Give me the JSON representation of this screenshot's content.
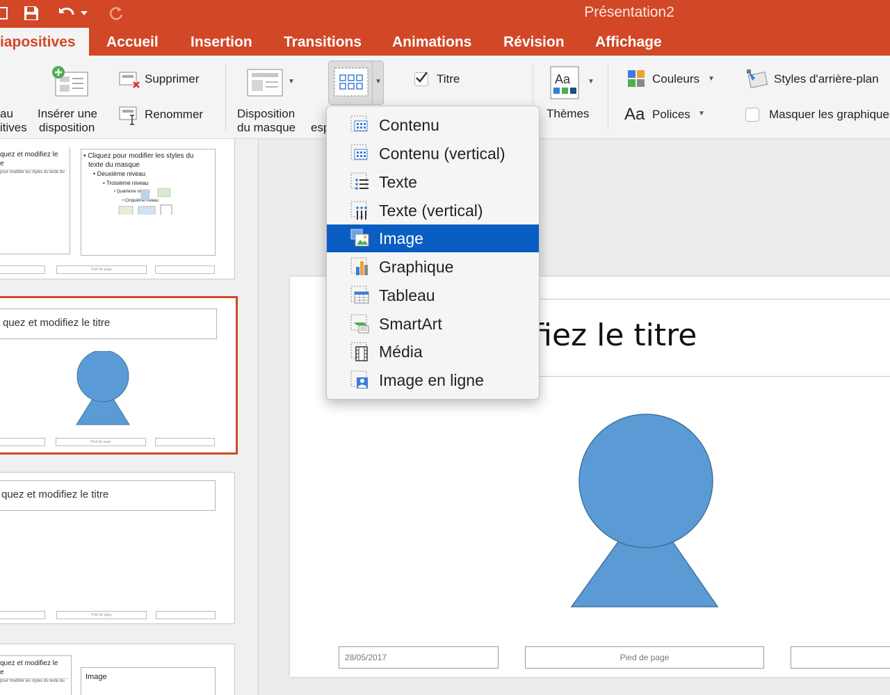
{
  "window": {
    "title": "Présentation2"
  },
  "tabs": [
    {
      "label": "Masque des diapositives",
      "visible_label": "iapositives",
      "active": true
    },
    {
      "label": "Accueil"
    },
    {
      "label": "Insertion"
    },
    {
      "label": "Transitions"
    },
    {
      "label": "Animations"
    },
    {
      "label": "Révision"
    },
    {
      "label": "Affichage"
    }
  ],
  "ribbon": {
    "insert_master_label_1": "au",
    "insert_master_label_2": "itives",
    "insert_layout_label_1": "Insérer une",
    "insert_layout_label_2": "disposition",
    "delete_label": "Supprimer",
    "rename_label": "Renommer",
    "master_layout_label_1": "Disposition",
    "master_layout_label_2": "du masque",
    "insert_placeholder_partial": "esp",
    "title_checkbox_label": "Titre",
    "themes_label": "Thèmes",
    "themes_icon_text": "Aa",
    "colors_label": "Couleurs",
    "fonts_label": "Polices",
    "fonts_icon_text": "Aa",
    "background_styles_label": "Styles d'arrière-plan",
    "hide_graphics_label": "Masquer les graphiques"
  },
  "placeholder_menu": {
    "items": [
      {
        "label": "Contenu",
        "icon": "content-icon"
      },
      {
        "label": "Contenu (vertical)",
        "icon": "content-vertical-icon"
      },
      {
        "label": "Texte",
        "icon": "text-icon"
      },
      {
        "label": "Texte (vertical)",
        "icon": "text-vertical-icon"
      },
      {
        "label": "Image",
        "icon": "image-icon",
        "highlighted": true
      },
      {
        "label": "Graphique",
        "icon": "chart-icon"
      },
      {
        "label": "Tableau",
        "icon": "table-icon"
      },
      {
        "label": "SmartArt",
        "icon": "smartart-icon"
      },
      {
        "label": "Média",
        "icon": "media-icon"
      },
      {
        "label": "Image en ligne",
        "icon": "online-image-icon"
      }
    ]
  },
  "thumbnails": {
    "t1_left_text": "quez et modifiez le",
    "t1_left_text2": "e",
    "t1_tiny": "pour modifier les styles du texte du",
    "t1_right_bullet1": "• Cliquez pour modifier les styles du",
    "t1_right_bullet1b": "texte du masque",
    "t1_right_bullet2": "• Deuxième niveau",
    "t1_right_bullet3": "• Troisième niveau",
    "t1_right_bullet4": "• Quatrième niveau",
    "t1_right_bullet5": "• Cinquième niveau",
    "t2_title": "quez et modifiez le titre",
    "t3_title": "quez et modifiez le titre",
    "t4_left_text": "quez et modifiez le",
    "t4_left_text2": "e",
    "t4_tiny": "pour modifier les styles du texte du",
    "t4_right_label": "Image",
    "footer_text": "Pied de page"
  },
  "slide": {
    "title": "Cliquez et modifiez le titre",
    "title_visible": "ifiez le titre",
    "date": "28/05/2017",
    "footer": "Pied de page"
  },
  "colors": {
    "accent": "#d24726",
    "shape": "#5b9bd5",
    "menu_highlight": "#0a5dc2"
  }
}
